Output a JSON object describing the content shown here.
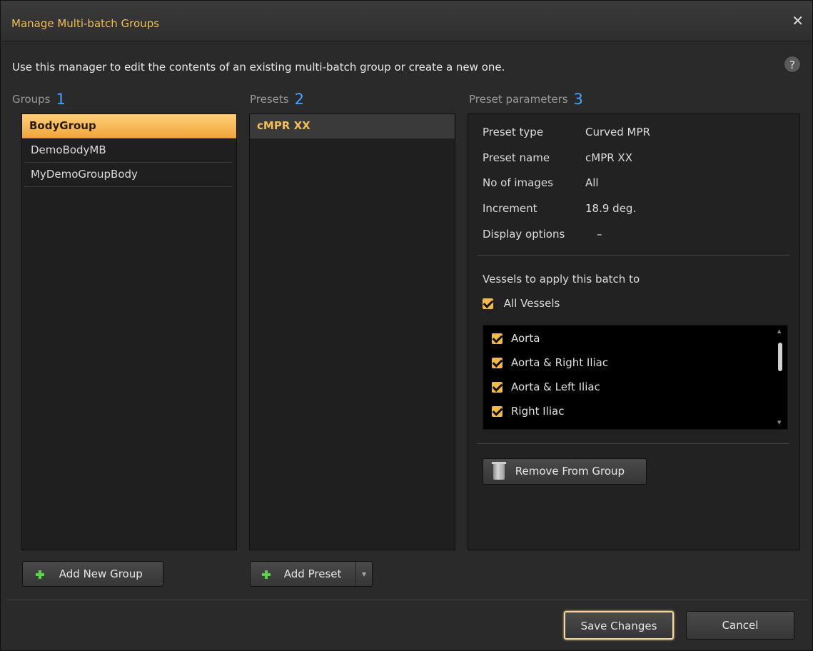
{
  "dialog": {
    "title": "Manage Multi-batch Groups",
    "close_glyph": "✕",
    "description": "Use this manager to edit the contents of an existing multi-batch group or create a new one.",
    "help_glyph": "?"
  },
  "columns": {
    "groups": {
      "label": "Groups",
      "num": "1"
    },
    "presets": {
      "label": "Presets",
      "num": "2"
    },
    "params": {
      "label": "Preset parameters",
      "num": "3"
    }
  },
  "groups": [
    {
      "label": "BodyGroup",
      "selected": true
    },
    {
      "label": "DemoBodyMB",
      "selected": false
    },
    {
      "label": "MyDemoGroupBody",
      "selected": false
    }
  ],
  "presets": [
    {
      "label": "cMPR XX",
      "selected": true
    }
  ],
  "params": {
    "rows": [
      {
        "label": "Preset type",
        "value": "Curved MPR"
      },
      {
        "label": "Preset name",
        "value": "cMPR XX"
      },
      {
        "label": "No of images",
        "value": "All"
      },
      {
        "label": "Increment",
        "value": "18.9 deg."
      },
      {
        "label": "Display options",
        "value": "–"
      }
    ],
    "vessels_heading": "Vessels to apply this batch to",
    "all_vessels_label": "All Vessels",
    "all_vessels_checked": true,
    "vessels": [
      {
        "label": "Aorta",
        "checked": true
      },
      {
        "label": "Aorta & Right Iliac",
        "checked": true
      },
      {
        "label": "Aorta & Left Iliac",
        "checked": true
      },
      {
        "label": "Right Iliac",
        "checked": true
      }
    ],
    "remove_button_label": "Remove From Group"
  },
  "buttons": {
    "add_group": "Add New Group",
    "add_preset": "Add Preset",
    "add_preset_dropdown_glyph": "▾",
    "save": "Save Changes",
    "cancel": "Cancel"
  },
  "icons": {
    "close": "close-icon",
    "help": "help-icon",
    "add": "plus-icon",
    "trash": "trash-icon",
    "check": "checkbox-check-icon"
  },
  "colors": {
    "accent": "#f2be5a",
    "selection": "#f5b84a",
    "number_blue": "#4aa3ff",
    "add_green": "#5ed14a"
  }
}
